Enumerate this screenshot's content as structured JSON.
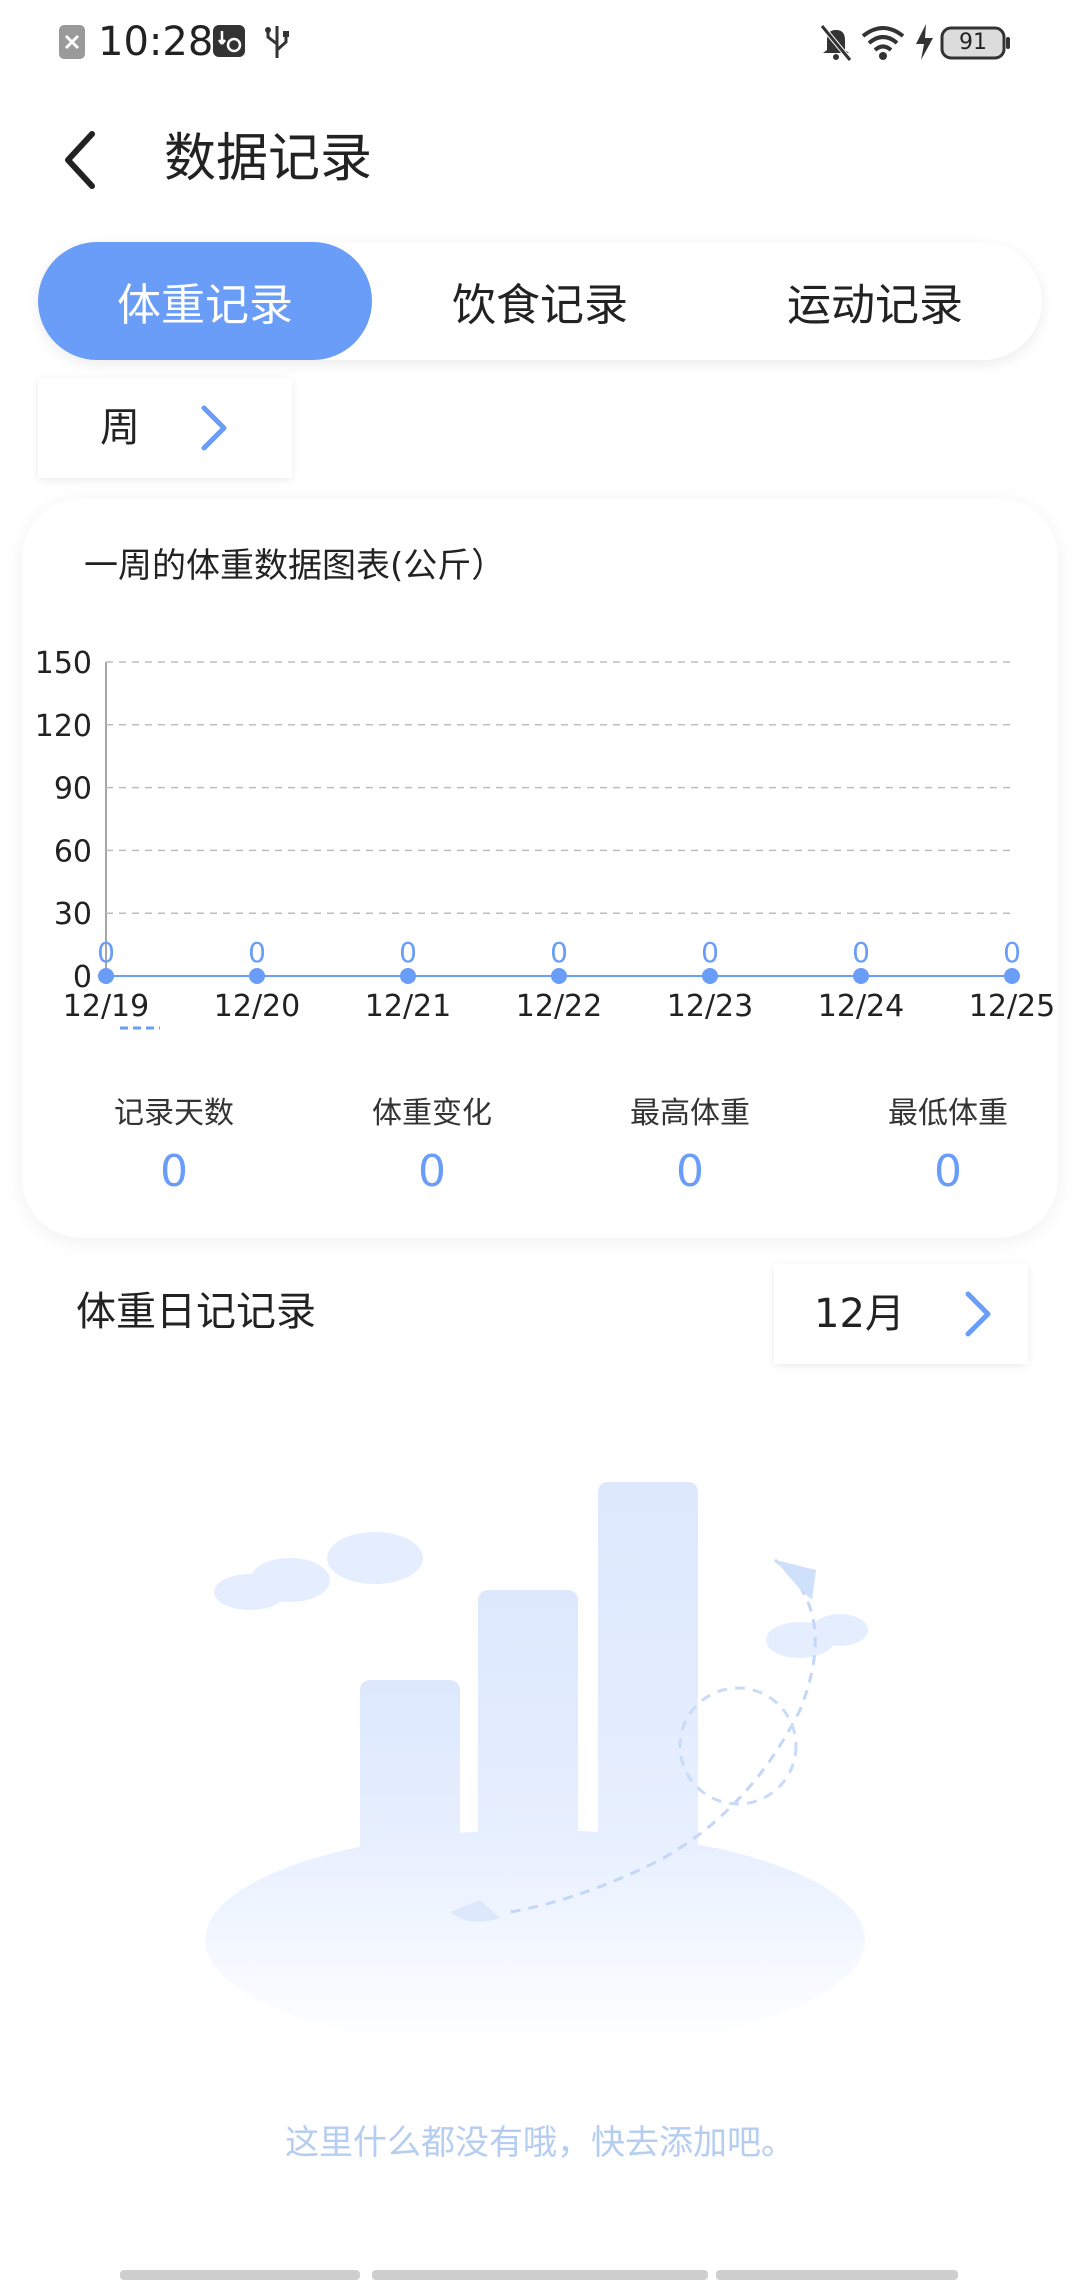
{
  "status_bar": {
    "time": "10:28",
    "battery": "91",
    "icons": [
      "close-square-icon",
      "data-settings-icon",
      "usb-icon",
      "bell-off-icon",
      "wifi-icon",
      "charging-bolt-icon",
      "battery-icon"
    ]
  },
  "header": {
    "title": "数据记录",
    "back_icon": "chevron-left-icon"
  },
  "tabs": [
    {
      "label": "体重记录",
      "active": true
    },
    {
      "label": "饮食记录",
      "active": false
    },
    {
      "label": "运动记录",
      "active": false
    }
  ],
  "period": {
    "label": "周",
    "icon": "chevron-right-icon"
  },
  "chart_card": {
    "title": "一周的体重数据图表(公斤）"
  },
  "chart_data": {
    "type": "line",
    "categories": [
      "12/19",
      "12/20",
      "12/21",
      "12/22",
      "12/23",
      "12/24",
      "12/25"
    ],
    "series": [
      {
        "values": [
          0,
          0,
          0,
          0,
          0,
          0,
          0
        ]
      }
    ],
    "yticks": [
      "0",
      "30",
      "60",
      "90",
      "120",
      "150"
    ],
    "ylim": [
      0,
      150
    ],
    "grid": true,
    "data_labels": [
      "0",
      "0",
      "0",
      "0",
      "0",
      "0",
      "0"
    ],
    "colors": {
      "line": "#6a9df7",
      "grid": "#bdbdbd"
    }
  },
  "stats": [
    {
      "label": "记录天数",
      "value": "0"
    },
    {
      "label": "体重变化",
      "value": "0"
    },
    {
      "label": "最高体重",
      "value": "0"
    },
    {
      "label": "最低体重",
      "value": "0"
    }
  ],
  "diary": {
    "title": "体重日记记录",
    "month": "12月",
    "month_icon": "chevron-right-icon"
  },
  "empty_state": {
    "text": "这里什么都没有哦，快去添加吧。"
  },
  "colors": {
    "accent": "#6a9df7",
    "empty_text": "#b5cdf0"
  }
}
